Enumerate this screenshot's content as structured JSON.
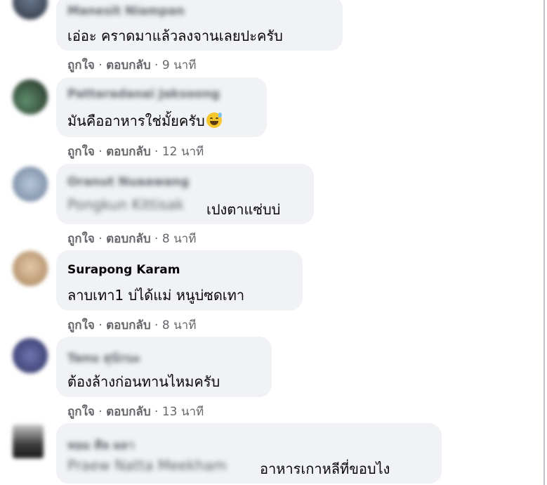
{
  "comments": [
    {
      "name": "Manesit Niampan",
      "text": "เอ่อะ คราดมาแล้วลงจานเลยปะครับ",
      "prefix": "",
      "like": "ถูกใจ",
      "reply": "ตอบกลับ",
      "time": "9 นาที"
    },
    {
      "name": "Pattaradanai Jaksoong",
      "text": "มันคืออาหารใช่มั้ยครับ",
      "emoji": "grinning-sweat-emoji",
      "prefix": "",
      "like": "ถูกใจ",
      "reply": "ตอบกลับ",
      "time": "12 นาที"
    },
    {
      "name": "Oranut Nuaawang",
      "text": "เปงตาแซ่บบ่",
      "prefix": "Pongkun Kittisak",
      "like": "ถูกใจ",
      "reply": "ตอบกลับ",
      "time": "8 นาที"
    },
    {
      "name": "Surapong Karam",
      "text": "ลาบเทา1 บ่ได้แม่ หนูบ่ซดเทา",
      "prefix": "",
      "like": "ถูกใจ",
      "reply": "ตอบกลับ",
      "time": "8 นาที"
    },
    {
      "name": "Tanu สุนักนะ",
      "text": "ต้องล้างก่อนทานไหมครับ",
      "prefix": "",
      "like": "ถูกใจ",
      "reply": "ตอบกลับ",
      "time": "13 นาที"
    },
    {
      "name": "หอม ศิล ผลา",
      "text": "อาหารเกาหลีที่ขอบไง",
      "prefix": "Praew Natta Meekham",
      "like": "",
      "reply": "",
      "time": ""
    }
  ],
  "separator": "·"
}
